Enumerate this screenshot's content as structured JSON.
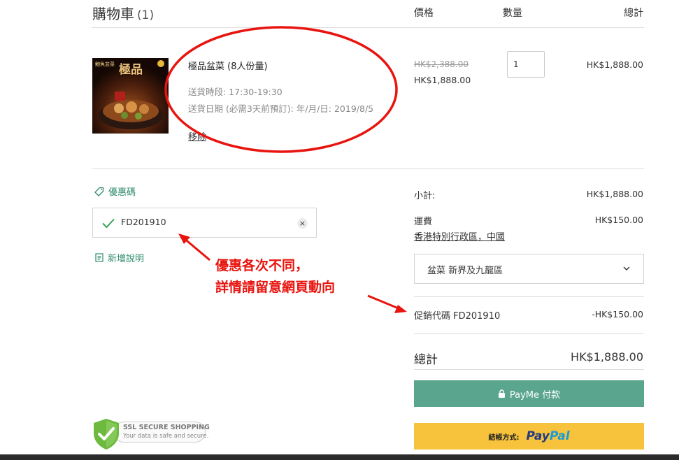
{
  "header": {
    "title": "購物車",
    "count": "(1)",
    "col_price": "價格",
    "col_qty": "數量",
    "col_total": "總計"
  },
  "product": {
    "image_text": "極品",
    "image_brand": "鮑魚盆菜",
    "name": "極品盆菜 (8人份量)",
    "delivery_time": "送貨時段: 17:30-19:30",
    "delivery_date": "送貨日期 (必需3天前預訂): 年/月/日: 2019/8/5",
    "remove_label": "移除",
    "price_original": "HK$2,388.00",
    "price_current": "HK$1,888.00",
    "quantity": "1",
    "line_total": "HK$1,888.00"
  },
  "coupon": {
    "link_label": "優惠碼",
    "code": "FD201910",
    "clear_icon": "×",
    "note_link_label": "新增說明"
  },
  "annotation": {
    "line1": "優惠各次不同，",
    "line2": "詳情請留意網頁動向"
  },
  "summary": {
    "subtotal_label": "小計:",
    "subtotal_value": "HK$1,888.00",
    "shipping_label": "運費",
    "shipping_value": "HK$150.00",
    "shipping_region": "香港特別行政區，中國",
    "shipping_option": "盆菜 新界及九龍區",
    "promo_label": "促銷代碼 FD201910",
    "promo_value": "-HK$150.00",
    "total_label": "總計",
    "total_value": "HK$1,888.00",
    "payme_label": "PayMe 付款",
    "paypal_prefix": "結帳方式:",
    "paypal_brand_1": "Pay",
    "paypal_brand_2": "Pal"
  },
  "ssl_badge": {
    "title": "SSL SECURE SHOPPING",
    "subtitle": "Your data is safe and secure."
  },
  "colors": {
    "accent_green": "#2e8b6a",
    "payme_green": "#5aa58d",
    "paypal_yellow": "#f7c33d",
    "annotation_red": "#e8140f"
  }
}
